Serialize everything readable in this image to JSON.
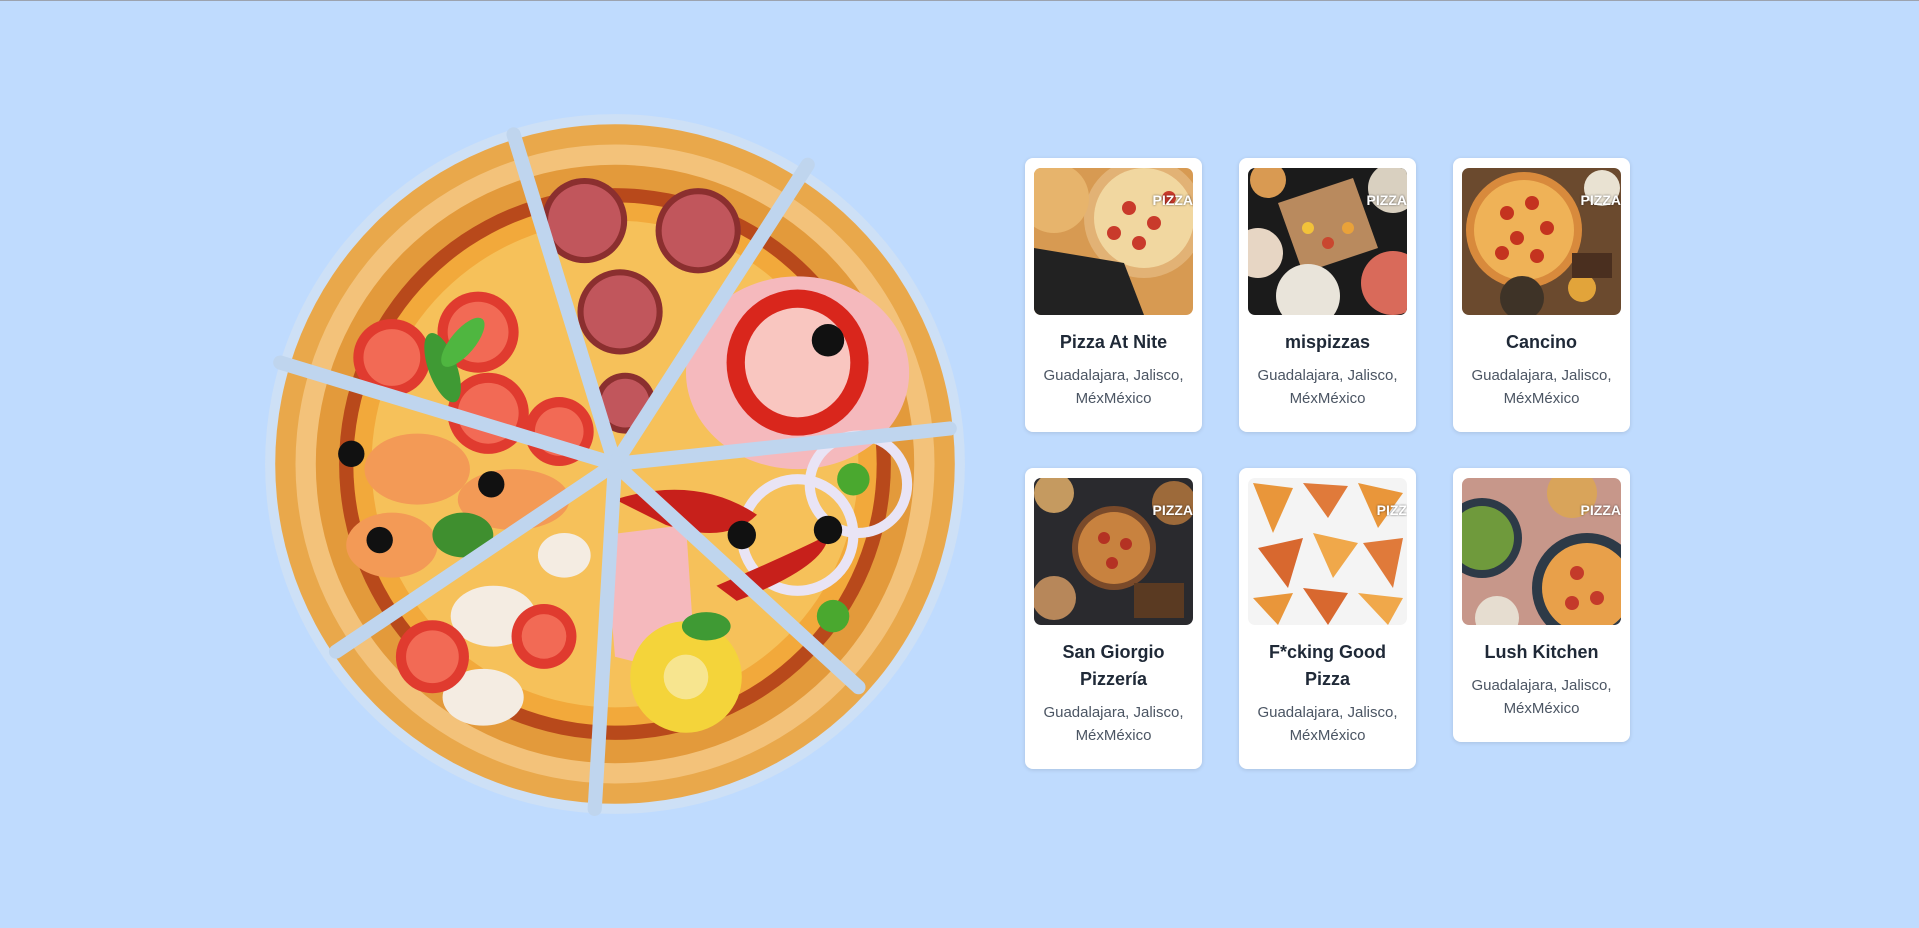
{
  "hero": {
    "image_name": "pizza-illustration"
  },
  "restaurants": [
    {
      "name": "Pizza At Nite",
      "location": "Guadalajara, Jalisco, MéxMéxico",
      "badge": "PIZZA"
    },
    {
      "name": "mispizzas",
      "location": "Guadalajara, Jalisco, MéxMéxico",
      "badge": "PIZZA"
    },
    {
      "name": "Cancino",
      "location": "Guadalajara, Jalisco, MéxMéxico",
      "badge": "PIZZA"
    },
    {
      "name": "San Giorgio Pizzería",
      "location": "Guadalajara, Jalisco, MéxMéxico",
      "badge": "PIZZA"
    },
    {
      "name": "F*cking Good Pizza",
      "location": "Guadalajara, Jalisco, MéxMéxico",
      "badge": "PIZZ"
    },
    {
      "name": "Lush Kitchen",
      "location": "Guadalajara, Jalisco, MéxMéxico",
      "badge": "PIZZA"
    }
  ],
  "colors": {
    "background": "#bfdbfe",
    "card": "#ffffff",
    "title": "#1f2937",
    "subtitle": "#4b5563"
  }
}
